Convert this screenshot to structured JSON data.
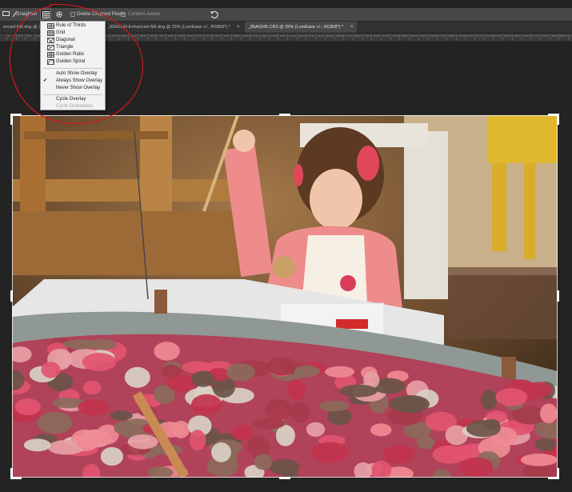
{
  "options_bar": {
    "straighten_label": "Straighten",
    "delete_pixels_label": "Delete Cropped Pixels",
    "content_aware_label": "Content-Aware"
  },
  "tabs": [
    {
      "label": "enced-NR.dng @ 2",
      "close": "×"
    },
    {
      "label": "_85A5142-Enhanced-NR.dng @ 25% (LumEase +/-, RGB/8*) *",
      "close": "×"
    },
    {
      "label": "_85A0345.CR3 @ 25% (LumEase +/-, RGB/8*) *",
      "close": "×"
    }
  ],
  "ruler": {
    "labels": [
      "0",
      "200",
      "300",
      "400",
      "500",
      "600",
      "700",
      "800",
      "900",
      "1000",
      "1100",
      "1200",
      "1300",
      "1400",
      "1500",
      "1600",
      "1700",
      "1800",
      "1900",
      "2000",
      "2100",
      "2200",
      "2300",
      "2400",
      "2500",
      "2600",
      "2700",
      "2800",
      "2900",
      "3000",
      "3100",
      "3200",
      "3300",
      "3400",
      "3500",
      "3600",
      "3700",
      "3800",
      "3900",
      "4000",
      "4100",
      "4200",
      "4300",
      "4400",
      "4500",
      "4600",
      "4700",
      "4800",
      "4900",
      "5000",
      "5100",
      "5200",
      "5300",
      "5400",
      "5500",
      "5600",
      "5700",
      "5800",
      "5900",
      "6000",
      "6100"
    ]
  },
  "overlay_menu": {
    "overlays": [
      "Rule of Thirds",
      "Grid",
      "Diagonal",
      "Triangle",
      "Golden Ratio",
      "Golden Spiral"
    ],
    "show_options": [
      "Auto Show Overlay",
      "Always Show Overlay",
      "Never Show Overlay"
    ],
    "selected_show_option_check": "✔",
    "cycle_overlay": "Cycle Overlay",
    "cycle_orientation": "Cycle Orientation"
  },
  "icons": {
    "crop_tool": "crop-icon",
    "overlay_options": "grid-overlay-icon",
    "settings": "gear-icon",
    "reset": "reset-icon"
  },
  "colors": {
    "annotation_red": "#d0181e",
    "options_bar_bg": "#474747",
    "workspace_bg": "#232323",
    "menu_bg": "#f2f2f2"
  }
}
